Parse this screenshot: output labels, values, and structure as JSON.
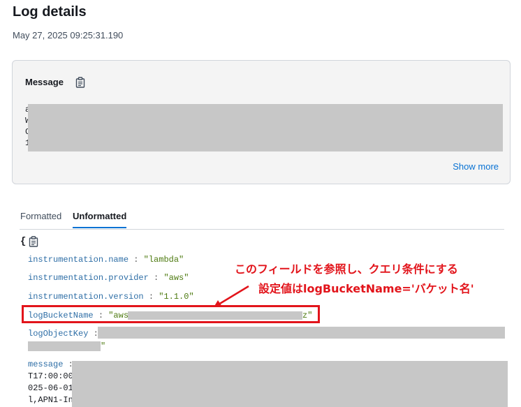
{
  "page": {
    "title": "Log details",
    "timestamp": "May 27, 2025 09:25:31.190"
  },
  "message_panel": {
    "label": "Message",
    "copy_icon": "copy-icon",
    "line_prefixes": [
      "a",
      "W",
      "C",
      "1"
    ],
    "show_more": "Show more"
  },
  "tabs": [
    {
      "label": "Formatted",
      "active": false
    },
    {
      "label": "Unformatted",
      "active": true
    }
  ],
  "json_view": {
    "open_brace": "{",
    "fields": [
      {
        "key": "instrumentation.name",
        "value": "\"lambda\""
      },
      {
        "key": "instrumentation.provider",
        "value": "\"aws\""
      },
      {
        "key": "instrumentation.version",
        "value": "\"1.1.0\""
      },
      {
        "key": "logBucketName",
        "value_start": "\"aws-",
        "value_end": "z\""
      },
      {
        "key": "logObjectKey",
        "value_end": "\""
      },
      {
        "key": "message",
        "lines": [
          "T17:00:00",
          "025-06-01",
          "l,APN1-Ing"
        ]
      }
    ],
    "separator": ":"
  },
  "annotation": {
    "line1": "このフィールドを参照し、クエリ条件にする",
    "line2": "設定値はlogBucketName='バケット名'",
    "color": "#e2141b"
  },
  "colors": {
    "accent": "#0972d3",
    "key": "#2e6ea6",
    "string": "#4d7a10",
    "redaction": "#c7c7c7"
  }
}
